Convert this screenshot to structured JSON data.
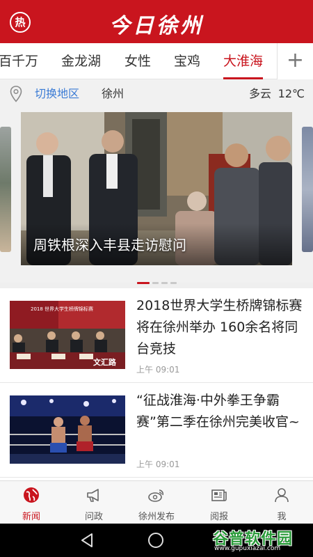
{
  "header": {
    "hot_label": "热",
    "title": "今日徐州",
    "color": "#c9151e"
  },
  "tabs": [
    {
      "label": "百千万",
      "active": false
    },
    {
      "label": "金龙湖",
      "active": false
    },
    {
      "label": "女性",
      "active": false
    },
    {
      "label": "宝鸡",
      "active": false
    },
    {
      "label": "大淮海",
      "active": true
    }
  ],
  "tab_add": "+",
  "location": {
    "icon": "location-pin-icon",
    "switch_label": "切换地区",
    "city": "徐州",
    "weather": "多云",
    "temperature": "12℃"
  },
  "carousel": {
    "caption": "周铁根深入丰县走访慰问",
    "page_count": 4,
    "active_index": 0
  },
  "news": [
    {
      "title": "2018世界大学生桥牌锦标赛将在徐州举办 160余名将同台竞技",
      "time": "上午 09:01",
      "thumb_banner": "2018 世界大学生桥牌锦标赛",
      "thumb_watermark": "文汇路"
    },
    {
      "title": "“征战淮海·中外拳王争霸赛”第二季在徐州完美收官~",
      "time": "上午 09:01"
    }
  ],
  "bottom_nav": [
    {
      "label": "新闻",
      "icon": "globe-icon",
      "active": true
    },
    {
      "label": "问政",
      "icon": "megaphone-icon",
      "active": false
    },
    {
      "label": "徐州发布",
      "icon": "weibo-icon",
      "active": false
    },
    {
      "label": "阅报",
      "icon": "newspaper-icon",
      "active": false
    },
    {
      "label": "我",
      "icon": "person-icon",
      "active": false
    }
  ],
  "system_bar": {
    "back_icon": "back-triangle-icon",
    "home_icon": "home-circle-icon"
  },
  "watermark": {
    "text": "谷普软件园",
    "url": "www.gupuxiazai.com"
  }
}
